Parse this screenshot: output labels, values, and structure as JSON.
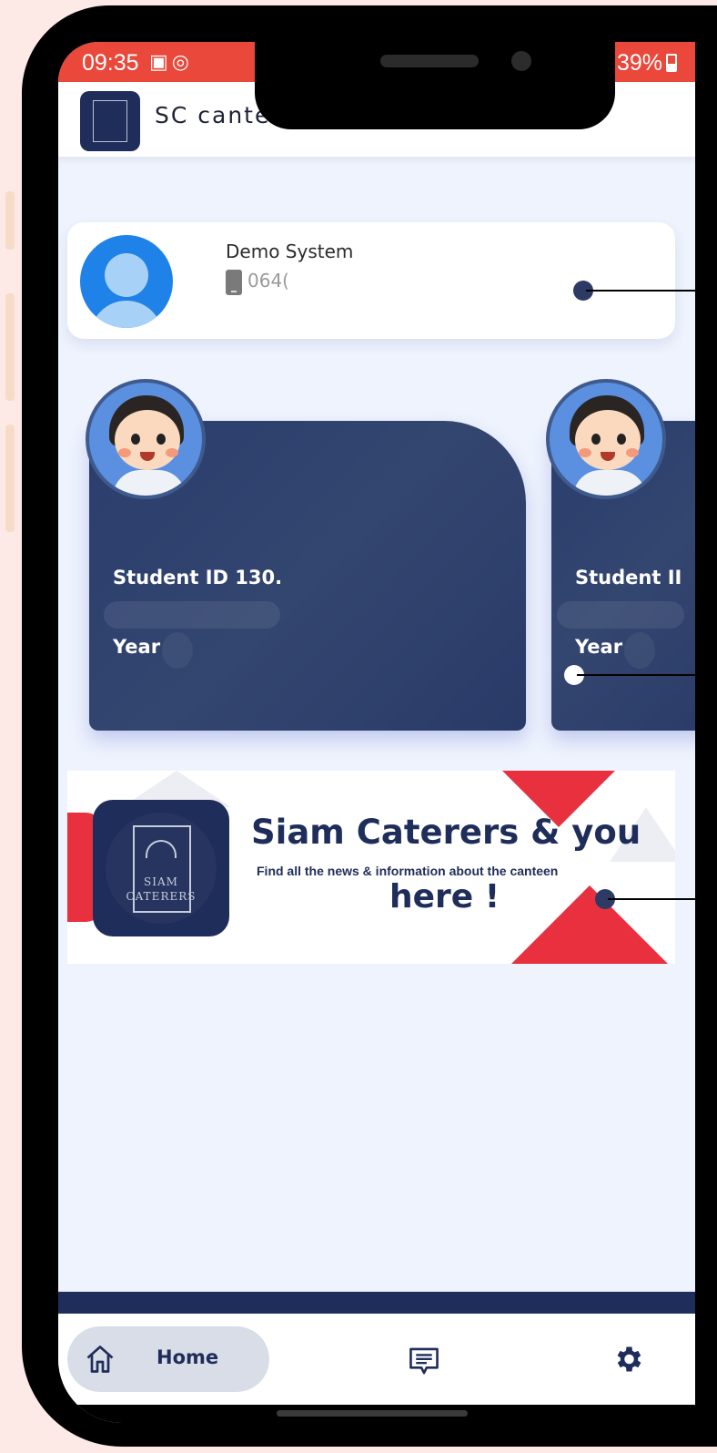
{
  "status_bar": {
    "time": "09:35",
    "battery": "39%"
  },
  "app_bar": {
    "title": "SC canteen"
  },
  "profile": {
    "name": "Demo System",
    "phone": "064("
  },
  "student_cards": [
    {
      "id_label": "Student ID 130.",
      "year_label": "Year"
    },
    {
      "id_label": "Student II",
      "year_label": "Year"
    }
  ],
  "banner": {
    "title": "Siam Caterers & you",
    "subtitle": "Find all the news & information about the canteen",
    "tagline": "here !",
    "logo_text": "SIAM CATERERS"
  },
  "bottom_nav": {
    "home_label": "Home"
  },
  "colors": {
    "status_bar": "#e9483a",
    "navy": "#1f2d5a",
    "accent_red": "#e8303f",
    "screen_bg": "#eef3fd"
  }
}
